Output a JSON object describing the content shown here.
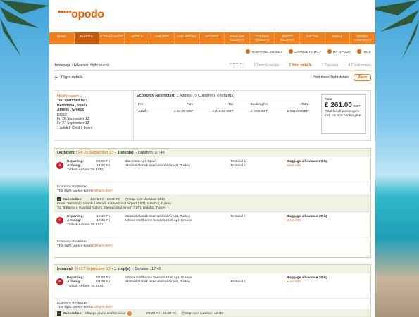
{
  "brand": {
    "name": "opodo",
    "dots": "●●●●●"
  },
  "nav": [
    "HOME",
    "FLIGHTS",
    "FLIGHT + HOTEL",
    "HOTELS",
    "CAR HIRE",
    "CITY BREAKS",
    "CRUISES",
    "PACKAGE HOLIDAYS",
    "COTTAGE HOLIDAYS",
    "OPODO ESCAPES",
    "THE USA",
    "DEALS",
    "OPODO CORPORATE"
  ],
  "util": [
    "SHOPPING BASKET",
    "CHANGE POLICY",
    "MY OPODO",
    "HELP"
  ],
  "crumb": "Homepage › Advanced flight search",
  "steps": [
    "1  Search results",
    "2  Your details",
    "3  Payment",
    "4  Confirmation"
  ],
  "flight_details": "Flight details",
  "print_link": "Print these flight details",
  "back": "Back",
  "summary": {
    "modify": "Modify search »",
    "searched": "You searched for:",
    "route1": "Barcelona , Spain",
    "route2": "Athens , Greece",
    "dates": "Dates:",
    "d1": "Fri 20 September 13",
    "d2": "Fri 27 September 13",
    "pax": "1 Adult 0 Child 0 Infant",
    "fare_title": "Economy Restricted",
    "fare_pax": ": 1 Adult(s), 0 Child(ren), 0 Infant(s)",
    "cols": [
      "Per",
      "Fare",
      "Tax",
      "Booking fee",
      "Total"
    ],
    "row": [
      "Adult:",
      "£ 42.00 GBP",
      "£ 219.00 GBP",
      "£ 0.00 GBP",
      "£ 261.00 GBP"
    ],
    "total_label": "Total",
    "total_amt": "£ 261.00",
    "total_cur": "GBP",
    "total_note": "Total for all passengers incl. tax and booking fee"
  },
  "outbound": {
    "label": "Outbound:",
    "date": "Fri 20 September 13",
    "stops": "- 1 stop(s)",
    "duration": "- Duration: 07:40",
    "leg1": {
      "dep_l": "Departing:",
      "arr_l": "Arriving:",
      "dep_t": "06:00 Fri",
      "arr_t": "13:25 Fri",
      "dep_p": "Barcelona Apt, Spain",
      "arr_p": "Istanbul Ataturk International Airport, Turkey",
      "term1": "Terminal 1",
      "term2": "Terminal I",
      "airline": "Turkish Airlines TK 1852",
      "bag": "Baggage allowance   20 kg",
      "more": "More info"
    },
    "notes": {
      "cls": "Economy Restricted",
      "tix": "This flight uses e-tickets",
      "what": "What's this?"
    },
    "conn": {
      "label": "Connection:",
      "time": "13:25 Fri - 12:40 Fri",
      "stop": "Stop-over duration: 2h15",
      "from": "From: Terminal I, Istanbul Ataturk International Airport (IST), Istanbul, Turkey",
      "to": "To: Terminal I, Istanbul Ataturk International Airport (IST), Istanbu, Turkey"
    },
    "leg2": {
      "dep_l": "Departing:",
      "arr_l": "Arriving:",
      "dep_t": "12:40 Fri",
      "arr_t": "17:40 Fri",
      "dep_p": "Istanbul Ataturk International Airport, Turkey",
      "arr_p": "Athens Eleftherios Venizelos Intl Apt, Greece",
      "term1": "Terminal I",
      "term2": "",
      "airline": "Turkish Airlines TK 1841",
      "bag": "Baggage allowance   20 kg",
      "more": "More info"
    },
    "notes2": {
      "cls": "Economy Restricted",
      "tix": "This flight uses e-tickets",
      "what": "What's this?"
    }
  },
  "inbound": {
    "label": "Inbound:",
    "date": "Fri 27 September 13",
    "stops": "- 1 stop(s)",
    "duration": "- Duration: 17:45",
    "leg1": {
      "dep_l": "Departing:",
      "arr_l": "Arriving:",
      "dep_t": "07:00 Fri",
      "arr_t": "08:30 Fri",
      "dep_p": "Athens Eleftherios Venizelos Intl Apt, Greece",
      "arr_p": "Istanbul Ataturk International Airport, Turkey",
      "term1": "",
      "term2": "Terminal I",
      "airline": "Turkish Airlines TK 1842",
      "bag": "Baggage allowance   20 kg",
      "more": "More info"
    },
    "notes": {
      "cls": "Economy Restricted",
      "tix": "This flight uses e-tickets",
      "what": "What's this?"
    },
    "conn": {
      "label": "Connection:",
      "text": "Change plane and terminal.",
      "time": "08:20 Fri - 21:00 Fri",
      "stop": "Stop-over duration: 12h40"
    }
  }
}
